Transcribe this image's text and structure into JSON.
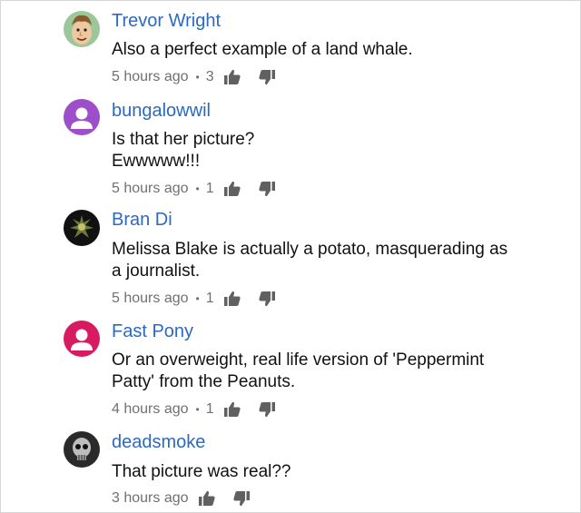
{
  "comments": [
    {
      "author": "Trevor Wright",
      "avatar": "cartoon-face-avatar",
      "lines": [
        "Also a perfect example of a land whale."
      ],
      "time": "5 hours ago",
      "likes": "3"
    },
    {
      "author": "bungalowwil",
      "avatar": "default-purple-avatar",
      "avatar_color": "#9c4fc8",
      "lines": [
        "Is that her picture?",
        "Ewwwww!!!"
      ],
      "time": "5 hours ago",
      "likes": "1"
    },
    {
      "author": "Bran Di",
      "avatar": "dark-photo-avatar",
      "lines": [
        "Melissa Blake is actually a potato, masquerading as",
        "a journalist."
      ],
      "time": "5 hours ago",
      "likes": "1"
    },
    {
      "author": "Fast Pony",
      "avatar": "default-pink-avatar",
      "avatar_color": "#d81b60",
      "lines": [
        "Or an overweight, real life version of 'Peppermint",
        "Patty' from the Peanuts."
      ],
      "time": "4 hours ago",
      "likes": "1"
    },
    {
      "author": "deadsmoke",
      "avatar": "skull-photo-avatar",
      "lines": [
        "That picture was real??"
      ],
      "time": "3 hours ago",
      "likes": ""
    }
  ],
  "colors": {
    "author_link": "#2b69c2",
    "meta_text": "#707070",
    "body_text": "#111111"
  },
  "icons": {
    "like": "thumbs-up-icon",
    "dislike": "thumbs-down-icon"
  }
}
